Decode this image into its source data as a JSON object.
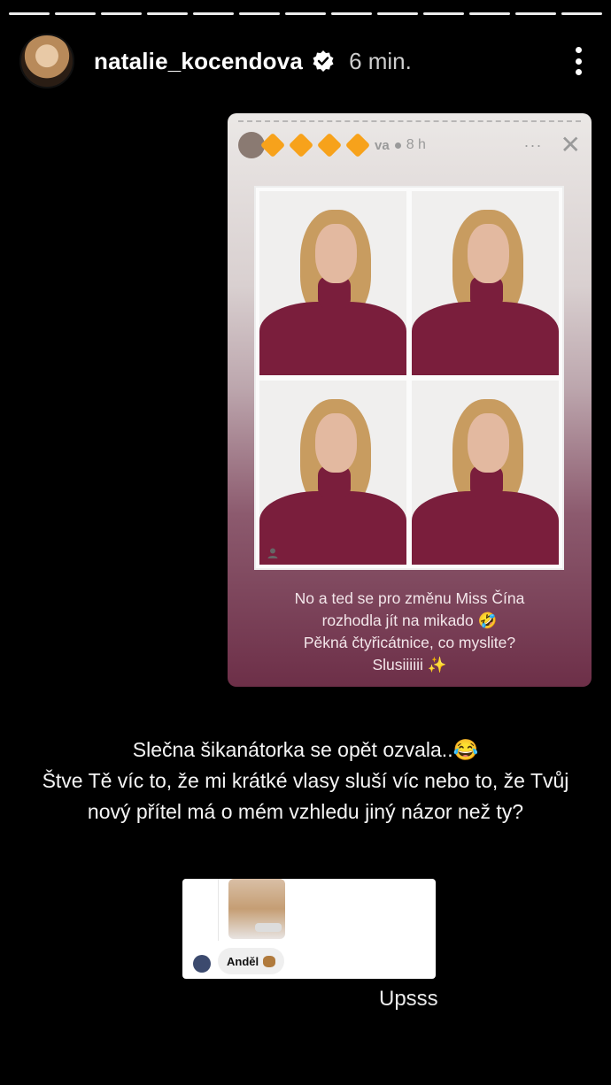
{
  "story": {
    "progress_segments": 13,
    "user": {
      "username": "natalie_kocendova",
      "time": "6 min."
    },
    "icons": {
      "verified": "verified-badge-icon",
      "more": "more-options-icon"
    }
  },
  "embedded_story": {
    "name_fragment": "va",
    "time": "8 h",
    "more": "···",
    "close": "✕",
    "caption": [
      "No a ted se pro změnu Miss Čína",
      "rozhodla jít na mikado 🤣",
      "Pěkná čtyřicátnice, co myslite?",
      "Slusiiiiii ✨"
    ]
  },
  "main_text": [
    "Slečna šikanátorka se opět ozvala..😂",
    "Štve Tě víc to, že mi krátké vlasy sluší víc nebo to, že Tvůj",
    "nový přítel má o mém vzhledu jiný názor než ty?"
  ],
  "reply": {
    "label": "Anděl"
  },
  "footer_text": "Upsss",
  "colors": {
    "background": "#000000",
    "accent_orange": "#f7a21b",
    "sweater": "#7a1e3c"
  }
}
